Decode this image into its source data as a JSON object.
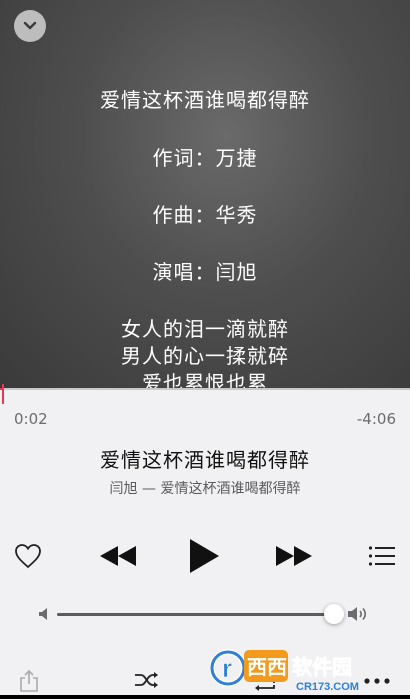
{
  "lyrics": [
    "爱情这杯酒谁喝都得醉",
    "作词：万捷",
    "作曲：华秀",
    "演唱：闫旭",
    "女人的泪一滴就醉",
    "男人的心一揉就碎",
    "爱也累恨也累"
  ],
  "player": {
    "elapsed": "0:02",
    "remaining": "-4:06",
    "progress_fraction": 0.008,
    "volume_fraction": 0.98,
    "title": "爱情这杯酒谁喝都得醉",
    "subtitle": "闫旭 — 爱情这杯酒谁喝都得醉"
  },
  "watermark": {
    "brand": "西西软件园",
    "url": "CR173.COM"
  },
  "colors": {
    "accent": "#e8384f",
    "panel": "#f1f1f3"
  }
}
